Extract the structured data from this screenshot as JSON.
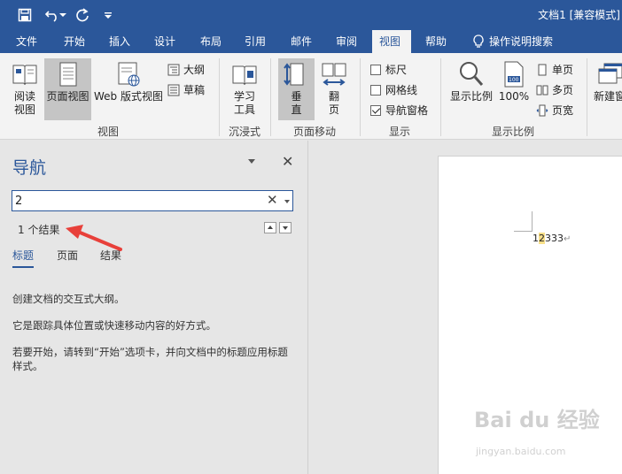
{
  "app": {
    "doc_title": "文档1 [兼容模式]"
  },
  "quick_access": {
    "save_icon": "save-icon",
    "undo_icon": "undo-icon",
    "redo_icon": "redo-icon",
    "customize_icon": "customize-qat-icon"
  },
  "menu": {
    "tabs": [
      {
        "label": "文件"
      },
      {
        "label": "开始"
      },
      {
        "label": "插入"
      },
      {
        "label": "设计"
      },
      {
        "label": "布局"
      },
      {
        "label": "引用"
      },
      {
        "label": "邮件"
      },
      {
        "label": "审阅"
      },
      {
        "label": "视图",
        "active": true
      },
      {
        "label": "帮助"
      }
    ],
    "tell_me": "操作说明搜索"
  },
  "ribbon": {
    "views": {
      "read_mode": "阅读\n视图",
      "read_mode_l1": "阅读",
      "read_mode_l2": "视图",
      "print_layout": "页面视图",
      "web_layout": "Web 版式视图",
      "outline": "大纲",
      "draft": "草稿",
      "group_label": "视图"
    },
    "immersive": {
      "learning_tools_l1": "学习",
      "learning_tools_l2": "工具",
      "group_label": "沉浸式"
    },
    "page_movement": {
      "vertical": "垂\n直",
      "vertical_l1": "垂",
      "vertical_l2": "直",
      "side_to_side_l1": "翻",
      "side_to_side_l2": "页",
      "group_label": "页面移动"
    },
    "show": {
      "ruler": "标尺",
      "ruler_checked": false,
      "gridlines": "网格线",
      "gridlines_checked": false,
      "nav_pane": "导航窗格",
      "nav_pane_checked": true,
      "group_label": "显示"
    },
    "zoom": {
      "zoom": "显示比例",
      "hundred": "100%",
      "one_page": "单页",
      "multiple_pages": "多页",
      "page_width": "页宽",
      "group_label": "显示比例"
    },
    "window": {
      "new_window": "新建窗"
    }
  },
  "nav_pane": {
    "title": "导航",
    "search_value": "2",
    "result_count": "1 个结果",
    "subtabs": [
      {
        "label": "标题",
        "active": true
      },
      {
        "label": "页面"
      },
      {
        "label": "结果"
      }
    ],
    "messages": [
      "创建文档的交互式大纲。",
      "它是跟踪具体位置或快速移动内容的好方式。",
      "若要开始，请转到“开始”选项卡，并向文档中的标题应用标题样式。"
    ]
  },
  "document": {
    "text_before": "1",
    "text_highlight": "2",
    "text_after": "333",
    "paragraph_mark": "↵"
  },
  "watermark": {
    "main": "Bai du 经验",
    "sub": "jingyan.baidu.com"
  },
  "colors": {
    "brand": "#2b579a",
    "highlight": "#f9e08a",
    "arrow": "#e8403a"
  }
}
